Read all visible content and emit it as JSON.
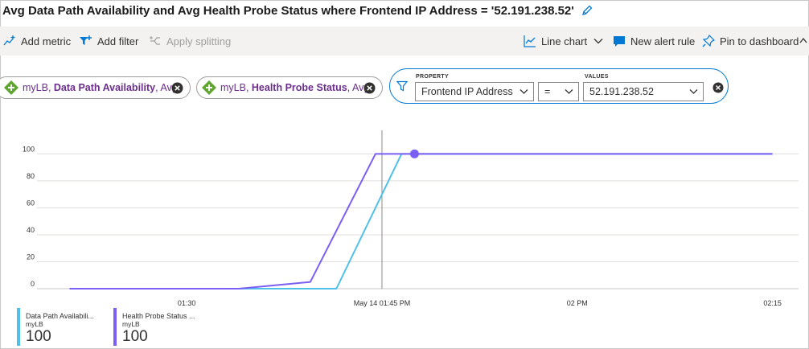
{
  "title": "Avg Data Path Availability and Avg Health Probe Status where Frontend IP Address = '52.191.238.52'",
  "toolbar": {
    "add_metric": "Add metric",
    "add_filter": "Add filter",
    "apply_splitting": "Apply splitting",
    "line_chart": "Line chart",
    "new_alert_rule": "New alert rule",
    "pin_to_dashboard": "Pin to dashboard"
  },
  "metric_pills": [
    {
      "resource": "myLB",
      "metric": "Data Path Availability",
      "aggregation": "Avg"
    },
    {
      "resource": "myLB",
      "metric": "Health Probe Status",
      "aggregation": "Avg"
    }
  ],
  "punct": {
    "comma": ", "
  },
  "filter": {
    "property_label": "PROPERTY",
    "property_value": "Frontend IP Address",
    "operator": "=",
    "values_label": "VALUES",
    "value": "52.191.238.52"
  },
  "chart_data": {
    "type": "line",
    "y_ticks": [
      0,
      20,
      40,
      60,
      80,
      100
    ],
    "ylim": [
      0,
      108
    ],
    "x_ticks": [
      {
        "label": "01:30",
        "t": 30
      },
      {
        "label": "May 14 01:45 PM",
        "t": 45
      },
      {
        "label": "02 PM",
        "t": 60
      },
      {
        "label": "02:15",
        "t": 75
      }
    ],
    "xlim": [
      18.5,
      77
    ],
    "cursor_t": 45,
    "grid": true,
    "series": [
      {
        "name": "Data Path Availability",
        "color": "#4fc0e8",
        "points": [
          [
            21,
            0
          ],
          [
            37,
            0
          ],
          [
            41.5,
            0
          ],
          [
            46.5,
            100
          ],
          [
            75,
            100
          ]
        ]
      },
      {
        "name": "Health Probe Status",
        "color": "#7b5ff5",
        "points": [
          [
            21,
            0
          ],
          [
            34,
            0
          ],
          [
            39.5,
            5
          ],
          [
            44.5,
            100
          ],
          [
            75,
            100
          ]
        ]
      }
    ],
    "highlight_point": {
      "t": 47.5,
      "v": 100
    }
  },
  "legend": [
    {
      "name": "Data Path Availabili...",
      "resource": "myLB",
      "value": "100",
      "color": "#4fc0e8"
    },
    {
      "name": "Health Probe Status ...",
      "resource": "myLB",
      "value": "100",
      "color": "#7b5ff5"
    }
  ]
}
